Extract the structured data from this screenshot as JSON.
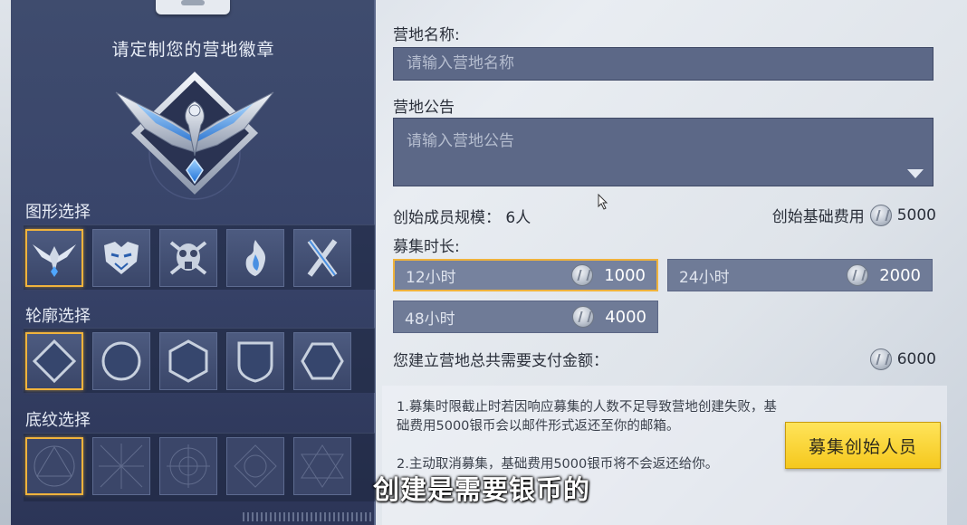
{
  "left": {
    "title": "请定制您的营地徽章",
    "shape_label": "图形选择",
    "outline_label": "轮廓选择",
    "pattern_label": "底纹选择",
    "shapes": [
      "eagle-icon",
      "tiger-icon",
      "gasmask-icon",
      "flame-icon",
      "crossed-blades-icon"
    ],
    "outlines": [
      "diamond-outline-icon",
      "circle-outline-icon",
      "hexagon-outline-icon",
      "shield-outline-icon",
      "hexagon-flat-outline-icon"
    ],
    "patterns": [
      "pattern-1-icon",
      "pattern-2-icon",
      "pattern-3-icon",
      "pattern-4-icon",
      "pattern-5-icon"
    ]
  },
  "form": {
    "name_label": "营地名称:",
    "name_placeholder": "请输入营地名称",
    "notice_label": "营地公告",
    "notice_placeholder": "请输入营地公告",
    "members_text": "创始成员规模：  6人",
    "base_fee_label": "创始基础费用",
    "base_fee_value": "5000",
    "duration_label": "募集时长:",
    "durations": [
      {
        "label": "12小时",
        "price": "1000"
      },
      {
        "label": "24小时",
        "price": "2000"
      },
      {
        "label": "48小时",
        "price": "4000"
      }
    ],
    "total_label": "您建立营地总共需要支付金额：",
    "total_value": "6000",
    "note1": "1.募集时限截止时若因响应募集的人数不足导致营地创建失败，基础费用5000银币会以邮件形式返还至你的邮箱。",
    "note2": "2.主动取消募集，基础费用5000银币将不会返还给你。",
    "recruit_button": "募集创始人员"
  },
  "subtitle": "创建是需要银币的",
  "colors": {
    "accent_selected": "#f0b33c",
    "button_yellow": "#f5c81d",
    "panel_dark": "#38446a"
  }
}
